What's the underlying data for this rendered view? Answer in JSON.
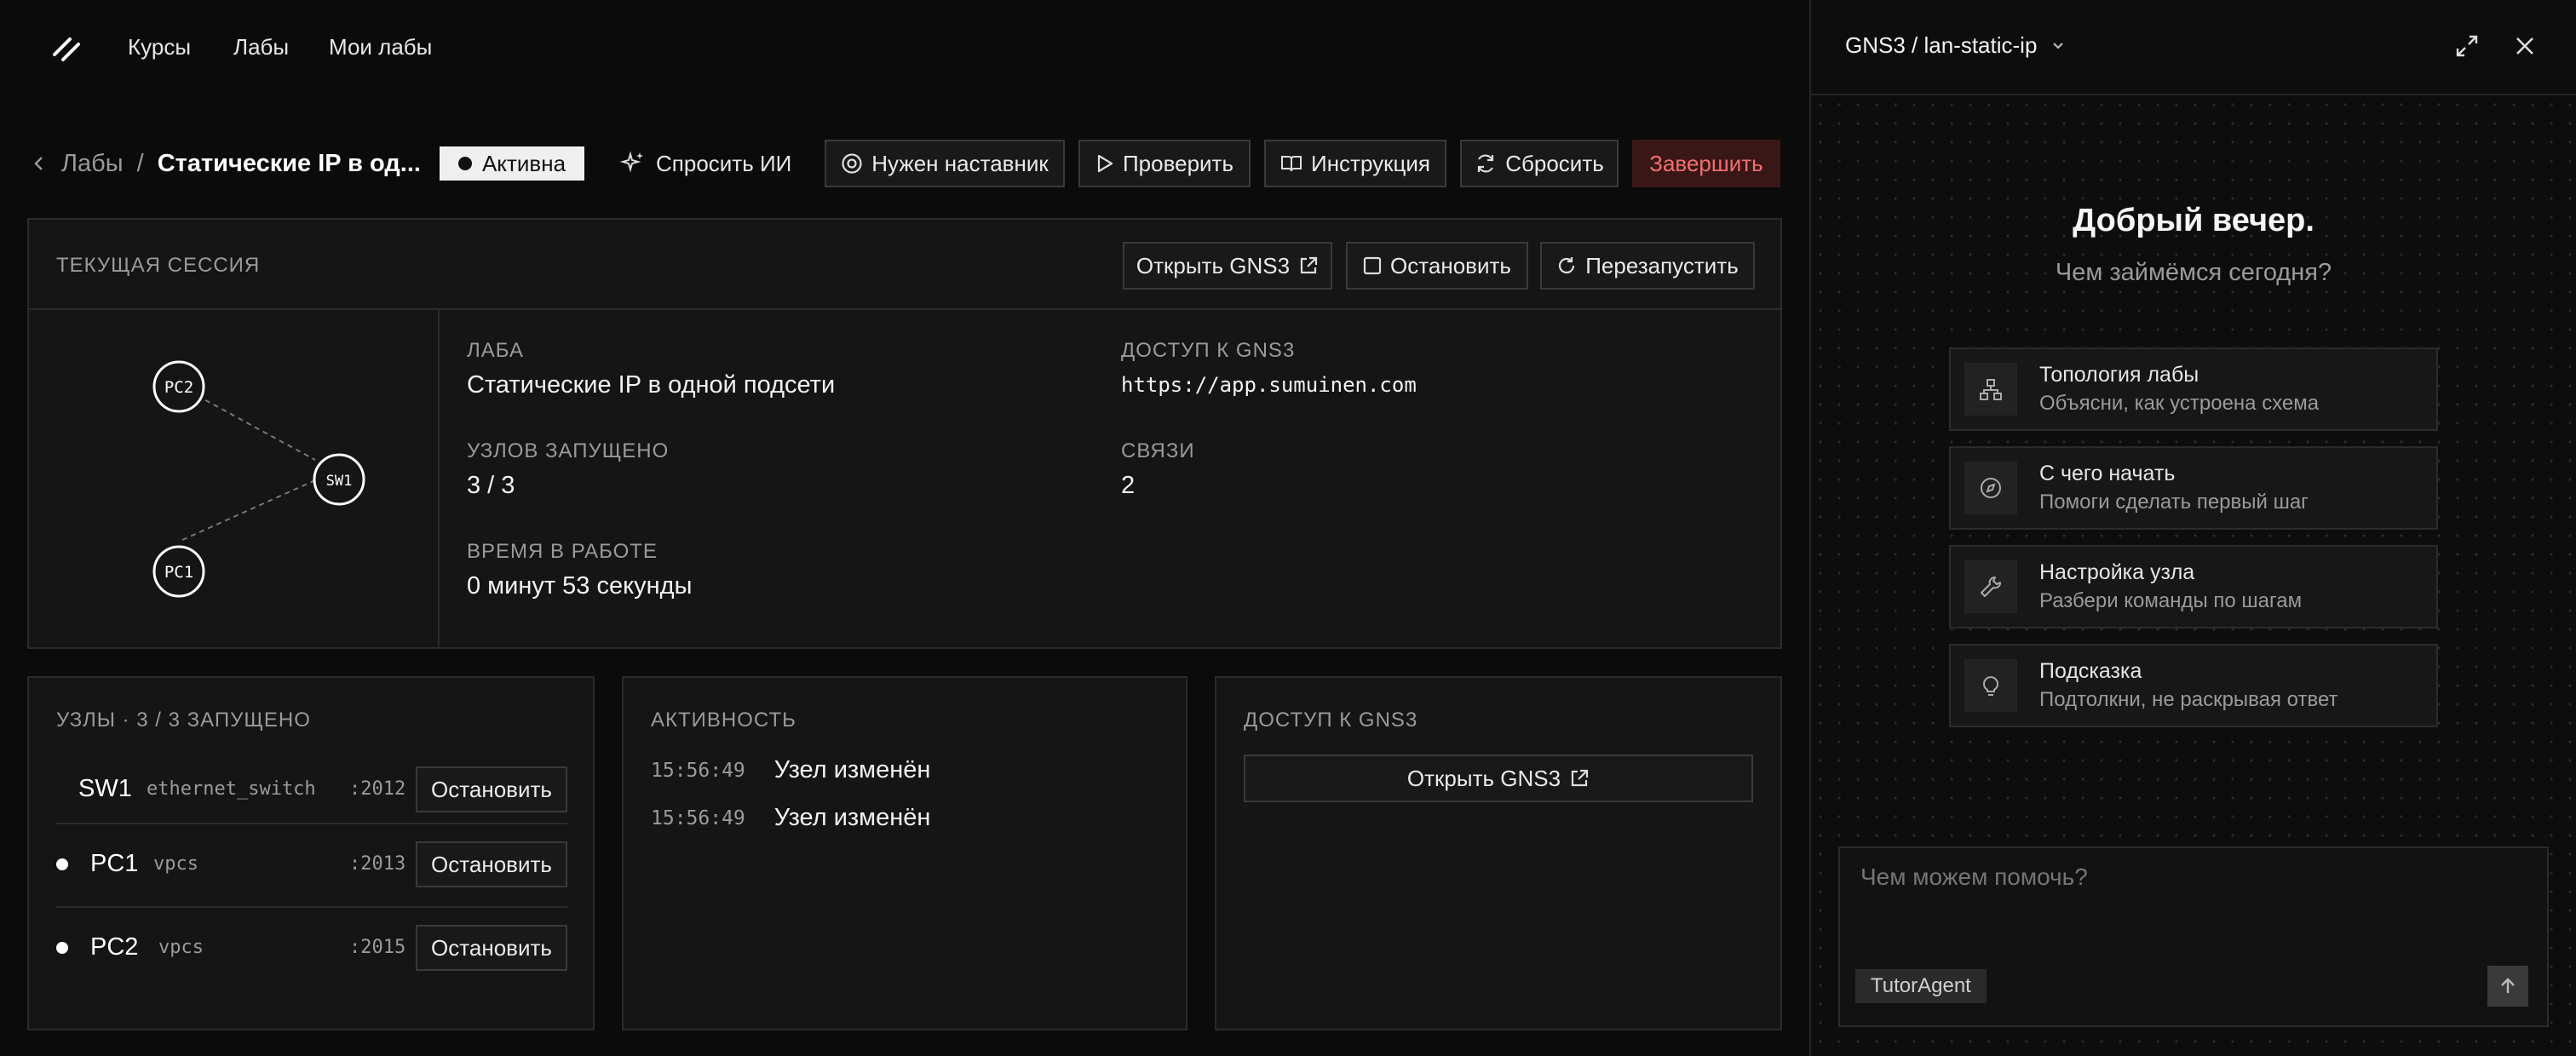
{
  "nav": {
    "courses": "Курсы",
    "labs": "Лабы",
    "my_labs": "Мои лабы"
  },
  "breadcrumb": {
    "parent": "Лабы",
    "sep": "/",
    "current": "Статические IP в од..."
  },
  "status_badge": "Активна",
  "toolbar": {
    "ask_ai": "Спросить ИИ",
    "need_mentor": "Нужен наставник",
    "check": "Проверить",
    "instructions": "Инструкция",
    "reset": "Сбросить",
    "finish": "Завершить"
  },
  "session": {
    "title": "Текущая сессия",
    "open_gns3": "Открыть GNS3",
    "stop": "Остановить",
    "restart": "Перезапустить",
    "lab_label": "Лаба",
    "lab_value": "Статические IP в одной подсети",
    "access_label": "Доступ к GNS3",
    "access_value": "https://app.sumuinen.com",
    "nodes_label": "Узлов запущено",
    "nodes_value": "3 / 3",
    "links_label": "Связи",
    "links_value": "2",
    "uptime_label": "Время в работе",
    "uptime_value": "0 минут 53 секунды",
    "topology": {
      "pc2": "PC2",
      "sw1": "SW1",
      "pc1": "PC1"
    }
  },
  "nodes_panel": {
    "title": "Узлы · 3 / 3 запущено",
    "rows": [
      {
        "name": "SW1",
        "type": "ethernet_switch",
        "port": ":2012",
        "action": "Остановить"
      },
      {
        "name": "PC1",
        "type": "vpcs",
        "port": ":2013",
        "action": "Остановить"
      },
      {
        "name": "PC2",
        "type": "vpcs",
        "port": ":2015",
        "action": "Остановить"
      }
    ]
  },
  "activity_panel": {
    "title": "Активность",
    "items": [
      {
        "time": "15:56:49",
        "text": "Узел изменён"
      },
      {
        "time": "15:56:49",
        "text": "Узел изменён"
      }
    ]
  },
  "access_panel": {
    "title": "Доступ к GNS3",
    "open": "Открыть GNS3"
  },
  "assistant": {
    "context": "GNS3 / lan-static-ip",
    "greeting": "Добрый вечер.",
    "subtitle": "Чем займёмся сегодня?",
    "suggestions": [
      {
        "icon": "topology-icon",
        "title": "Топология лабы",
        "desc": "Объясни, как устроена схема"
      },
      {
        "icon": "compass-icon",
        "title": "С чего начать",
        "desc": "Помоги сделать первый шаг"
      },
      {
        "icon": "wrench-icon",
        "title": "Настройка узла",
        "desc": "Разбери команды по шагам"
      },
      {
        "icon": "lightbulb-icon",
        "title": "Подсказка",
        "desc": "Подтолкни, не раскрывая ответ"
      }
    ],
    "input_placeholder": "Чем можем помочь?",
    "agent_tag": "TutorAgent"
  },
  "colors": {
    "background": "#0b0b0b",
    "panel": "#151515",
    "finish_bg": "#3a1717",
    "finish_text": "#f07070",
    "badge_bg": "#efefef"
  }
}
